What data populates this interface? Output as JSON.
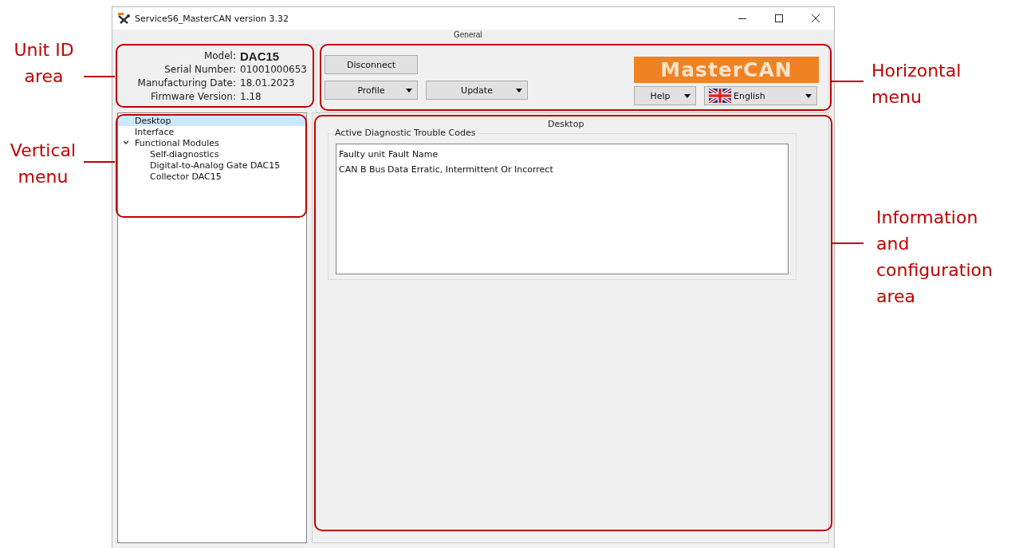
{
  "window": {
    "title": "ServiceS6_MasterCAN version 3.32"
  },
  "unit_info": [
    {
      "label": "Model:",
      "value": "DAC15",
      "kind": "model"
    },
    {
      "label": "Serial Number:",
      "value": "01001000653",
      "kind": "plain"
    },
    {
      "label": "Manufacturing Date:",
      "value": "18.01.2023",
      "kind": "plain"
    },
    {
      "label": "Firmware Version:",
      "value": "1.18",
      "kind": "plain"
    }
  ],
  "general": {
    "title": "General",
    "buttons": [
      {
        "label": "Disconnect",
        "kind": "plain"
      },
      {
        "label": "Profile",
        "kind": "dropdown"
      },
      {
        "label": "Update",
        "kind": "dropdown"
      }
    ],
    "logo": "MasterCAN",
    "help": "Help",
    "language": "English"
  },
  "tree": [
    {
      "label": "Desktop",
      "selected": true
    },
    {
      "label": "Interface",
      "selected": false
    },
    {
      "label": "Functional Modules",
      "selected": false,
      "expanded": true,
      "children": [
        {
          "label": "Self-diagnostics",
          "selected": false
        },
        {
          "label": "Digital-to-Analog Gate DAC15",
          "selected": false
        },
        {
          "label": "Collector DAC15",
          "selected": false
        }
      ]
    }
  ],
  "desktop": {
    "title": "Desktop",
    "group": "Active Diagnostic Trouble Codes",
    "columns": [
      "Faulty unit",
      "Fault Name"
    ],
    "rows": [
      [
        "CAN B Bus",
        "Data Erratic, Intermittent Or Incorrect"
      ]
    ]
  },
  "annotations": [
    {
      "label": "Unit ID\narea"
    },
    {
      "label": "Horizontal\nmenu"
    },
    {
      "label": "Vertical\nmenu"
    },
    {
      "label": "Information\nand\nconfiguration\narea"
    }
  ]
}
